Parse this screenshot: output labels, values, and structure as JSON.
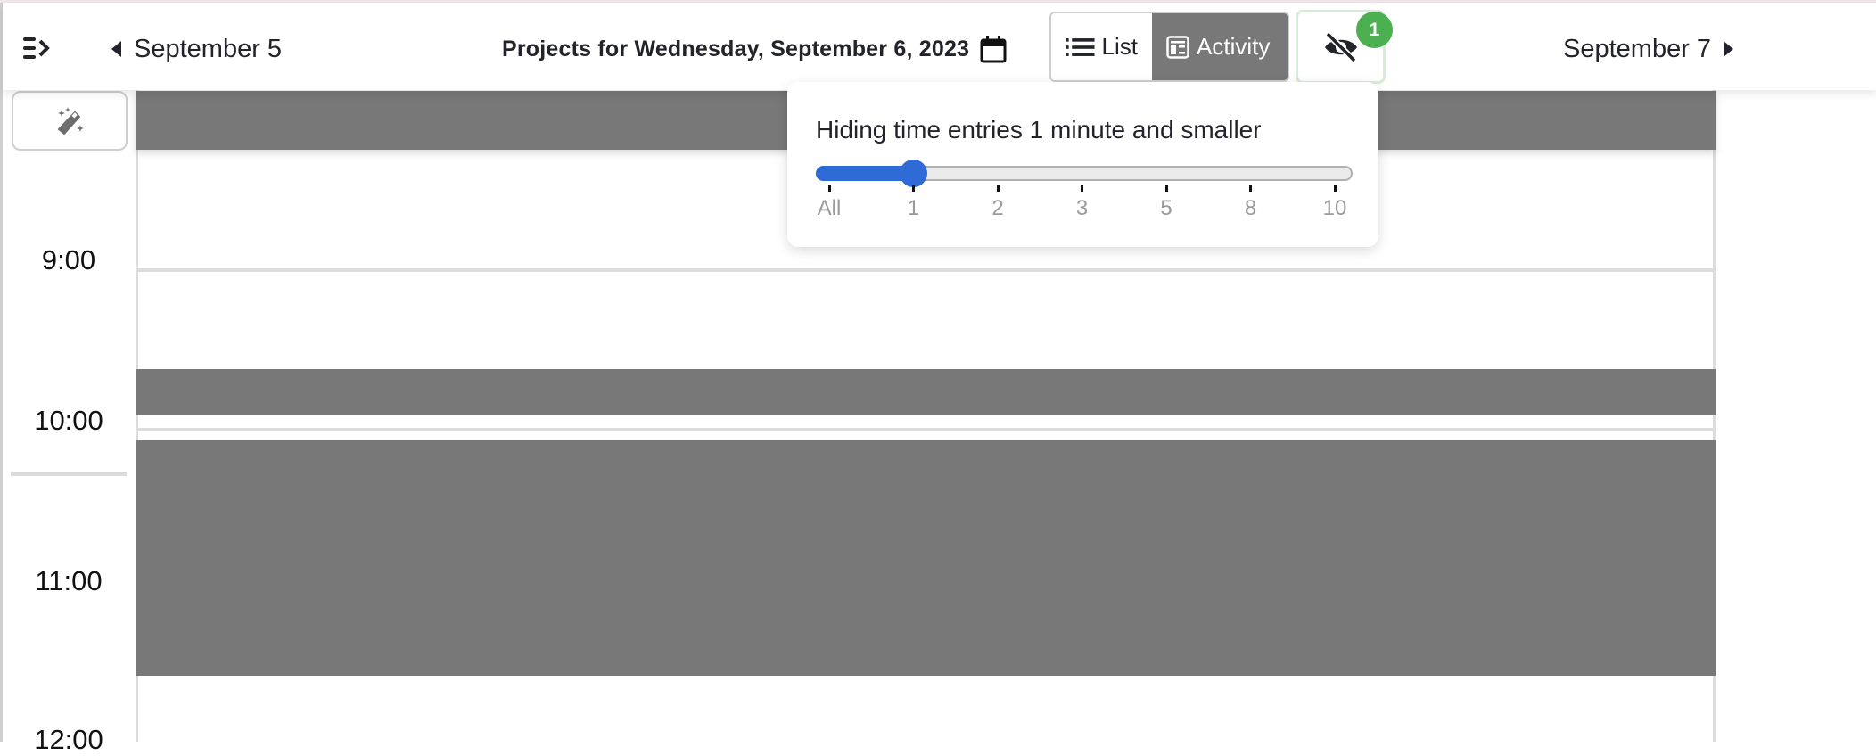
{
  "header": {
    "menu_icon": "collapse-sidebar-icon",
    "prev_day_label": "September 5",
    "next_day_label": "September 7",
    "title": "Projects for Wednesday, September 6, 2023",
    "calendar_icon": "calendar-icon",
    "views": [
      {
        "label": "List",
        "icon": "list-icon",
        "active": false
      },
      {
        "label": "Activity",
        "icon": "activity-icon",
        "active": true
      }
    ],
    "hide_button_icon": "eye-slash-icon",
    "hidden_count_badge": "1",
    "badge_color": "#4caf50"
  },
  "popover": {
    "text": "Hiding time entries 1 minute and smaller",
    "slider": {
      "options": [
        "All",
        "1",
        "2",
        "3",
        "5",
        "8",
        "10"
      ],
      "selected_index": 1,
      "selected_value": "1",
      "accent_color": "#2f6bd6"
    }
  },
  "sidebar": {
    "wand_icon": "magic-wand-icon",
    "time_labels": [
      "9:00",
      "10:00",
      "11:00",
      "12:00"
    ]
  },
  "timeline": {
    "entry_color": "#787878",
    "entries": [
      {
        "name": "time-entry-1"
      },
      {
        "name": "time-entry-2"
      },
      {
        "name": "time-entry-3"
      }
    ]
  }
}
